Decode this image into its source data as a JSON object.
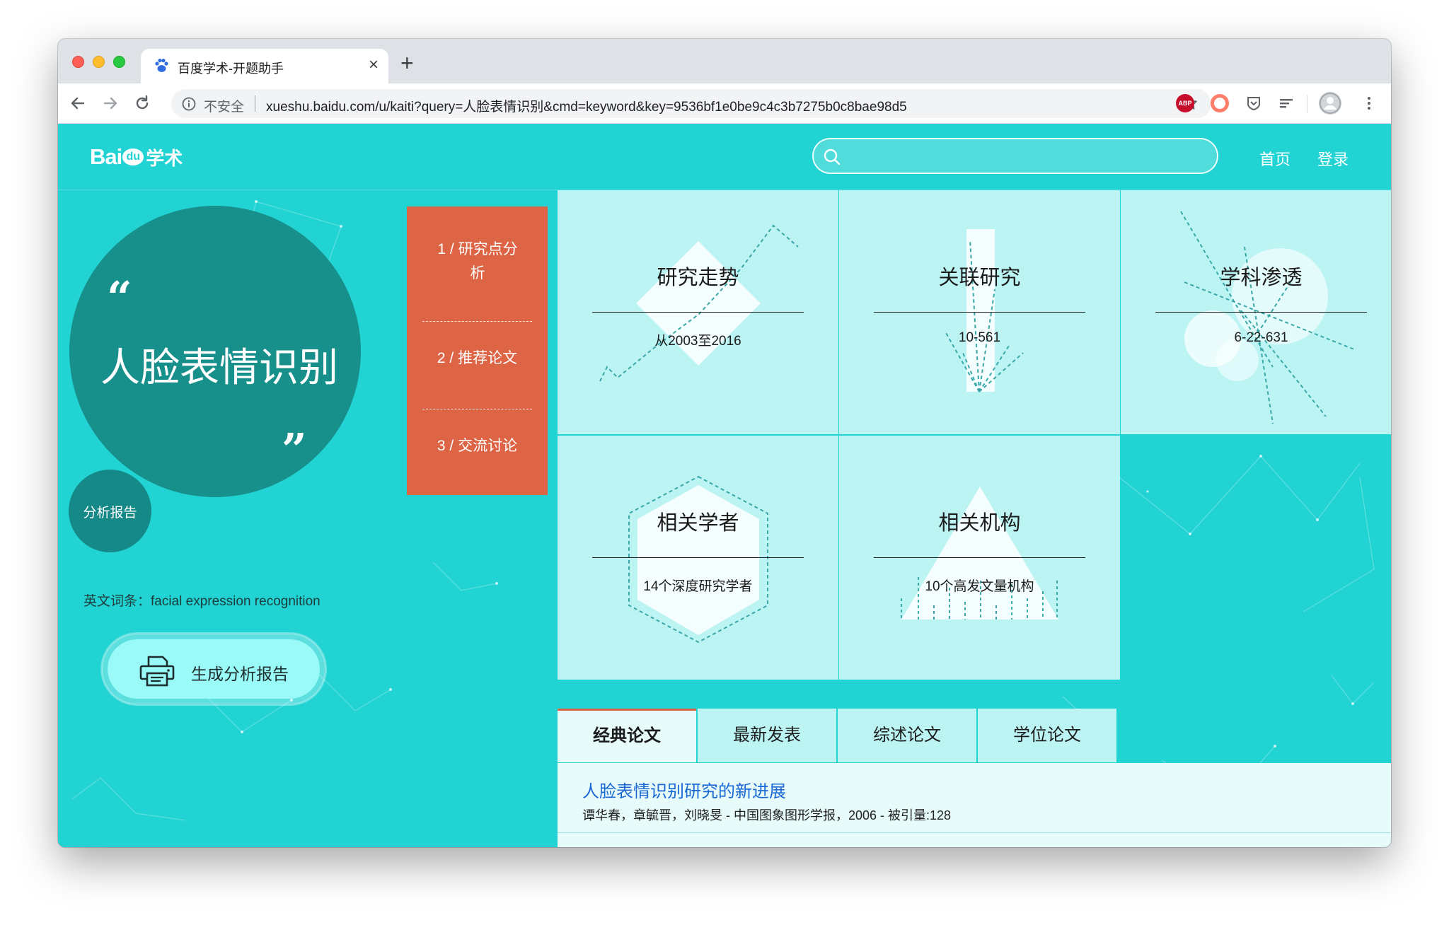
{
  "browser": {
    "tab_title": "百度学术-开题助手",
    "security_label": "不安全",
    "url": "xueshu.baidu.com/u/kaiti?query=人脸表情识别&cmd=keyword&key=9536bf1e0be9c4c3b7275b0c8bae98d5",
    "icons": [
      "back-icon",
      "forward-icon",
      "reload-icon",
      "info-icon",
      "star-icon",
      "adblock-icon",
      "extension-ring-icon",
      "shield-extension-icon",
      "list-extension-icon",
      "profile-icon",
      "menu-kebab-icon"
    ],
    "adblock_label": "ABP"
  },
  "header": {
    "logo_text": "Bai",
    "logo_du": "du",
    "logo_suffix": "学术",
    "search_placeholder": "",
    "nav": [
      "首页",
      "登录"
    ]
  },
  "topic": {
    "keyword": "人脸表情识别",
    "badge": "分析报告",
    "english_term": "英文词条：facial expression recognition",
    "generate_button": "生成分析报告"
  },
  "menu": [
    {
      "label": "1 / 研究点分析"
    },
    {
      "label": "2 / 推荐论文"
    },
    {
      "label": "3 / 交流讨论"
    }
  ],
  "cards": [
    {
      "title": "研究走势",
      "sub": "从2003至2016"
    },
    {
      "title": "关联研究",
      "sub": "10-561"
    },
    {
      "title": "学科渗透",
      "sub": "6-22-631"
    },
    {
      "title": "相关学者",
      "sub": "14个深度研究学者"
    },
    {
      "title": "相关机构",
      "sub": "10个高发文量机构"
    }
  ],
  "paper_tabs": [
    "经典论文",
    "最新发表",
    "综述论文",
    "学位论文"
  ],
  "results": [
    {
      "title": "人脸表情识别研究的新进展",
      "meta": "谭华春，章毓晋，刘晓旻 - 中国图象图形学报，2006 - 被引量:128"
    }
  ],
  "colors": {
    "page_bg": "#21d3d3",
    "dark_circle": "#178f8b",
    "menu_orange": "#dd6546",
    "card_bg": "#bcf4f4",
    "link_blue": "#1a68d4"
  }
}
